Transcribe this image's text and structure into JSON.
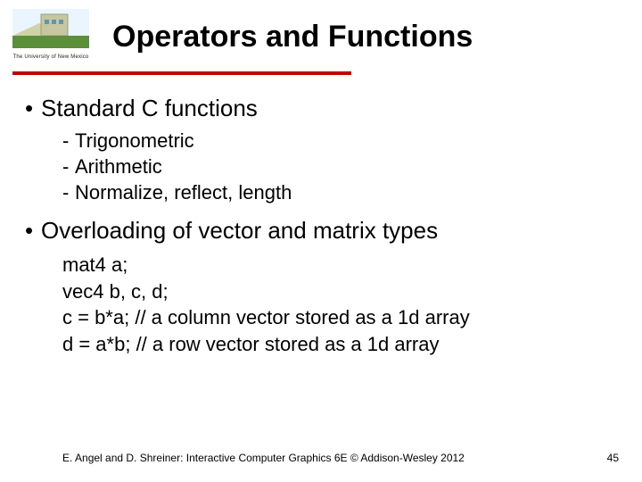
{
  "logo": {
    "caption": "The University of New Mexico"
  },
  "title": "Operators and Functions",
  "body": {
    "b1": {
      "text": "Standard C functions",
      "sub": [
        "Trigonometric",
        "Arithmetic",
        "Normalize, reflect, length"
      ]
    },
    "b2": {
      "text": "Overloading of vector and matrix types",
      "code": [
        "mat4 a;",
        "vec4 b, c, d;",
        "c = b*a; // a column vector stored as a 1d array",
        "d = a*b; // a row vector stored as a 1d array"
      ]
    }
  },
  "footer": "E. Angel and D. Shreiner: Interactive Computer Graphics 6E © Addison-Wesley 2012",
  "page": "45",
  "colors": {
    "accent": "#c00000"
  }
}
